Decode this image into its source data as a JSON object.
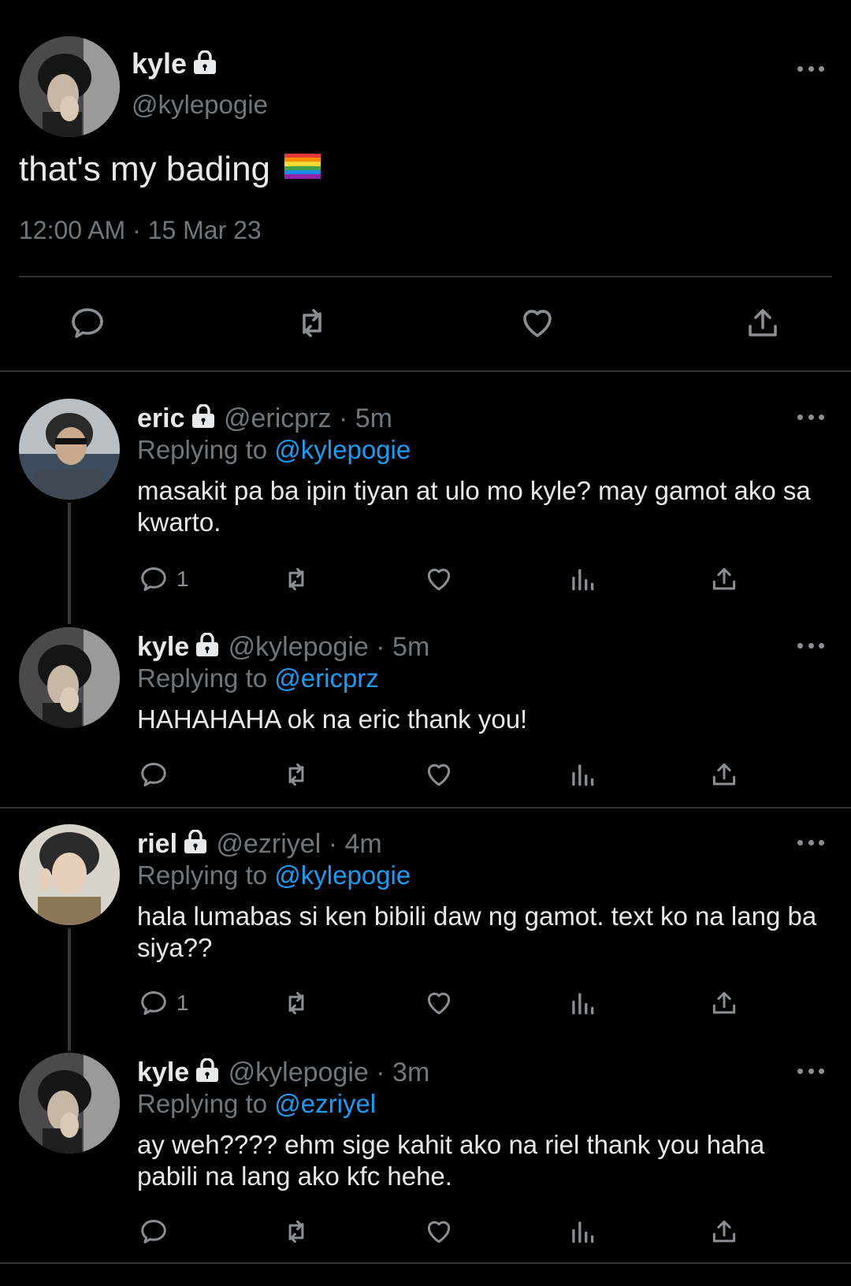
{
  "main_tweet": {
    "name": "kyle",
    "handle": "@kylepogie",
    "text": "that's my bading",
    "emoji": "🏳️‍🌈",
    "timestamp": "12:00 AM · 15 Mar 23"
  },
  "replies": [
    {
      "name": "eric",
      "handle": "@ericprz",
      "time": "· 5m",
      "replying_prefix": "Replying to",
      "replying_to": "@kylepogie",
      "text": "masakit pa ba ipin tiyan at ulo mo kyle? may gamot ako sa kwarto.",
      "reply_count": "1"
    },
    {
      "name": "kyle",
      "handle": "@kylepogie",
      "time": "· 5m",
      "replying_prefix": "Replying to",
      "replying_to": "@ericprz",
      "text": "HAHAHAHA ok na eric thank you!",
      "reply_count": ""
    },
    {
      "name": "riel",
      "handle": "@ezriyel",
      "time": "· 4m",
      "replying_prefix": "Replying to",
      "replying_to": "@kylepogie",
      "text": "hala lumabas si ken bibili daw ng gamot. text ko na lang ba siya??",
      "reply_count": "1"
    },
    {
      "name": "kyle",
      "handle": "@kylepogie",
      "time": "· 3m",
      "replying_prefix": "Replying to",
      "replying_to": "@ezriyel",
      "text": "ay weh???? ehm sige kahit ako na riel thank you haha pabili na lang ako kfc hehe.",
      "reply_count": ""
    }
  ],
  "icons": [
    "reply-icon",
    "retweet-icon",
    "like-icon",
    "analytics-icon",
    "share-icon",
    "lock-icon",
    "more-icon"
  ]
}
